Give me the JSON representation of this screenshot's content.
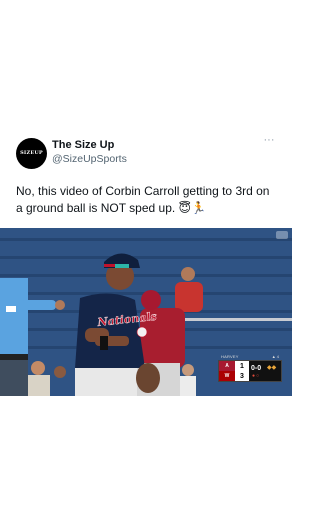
{
  "post": {
    "avatar_text": "SIZEUP",
    "display_name": "The Size Up",
    "handle": "@SizeUpSports",
    "more_icon": "more-horizontal-icon",
    "text": "No, this video of Corbin Carroll getting to 3rd on a ground ball is NOT sped up. 😇🏃"
  },
  "video": {
    "jersey_text": "Nationals",
    "scorebug": {
      "batter": "HARVEY",
      "inning": "▲ 4",
      "team1": "A",
      "score1": "1",
      "team2": "W",
      "score2": "3",
      "count": "0-0",
      "outs": "●○"
    }
  },
  "colors": {
    "text_primary": "#0f1419",
    "text_secondary": "#536471",
    "nationals_red": "#ab0003",
    "dbacks_red": "#a71930"
  }
}
